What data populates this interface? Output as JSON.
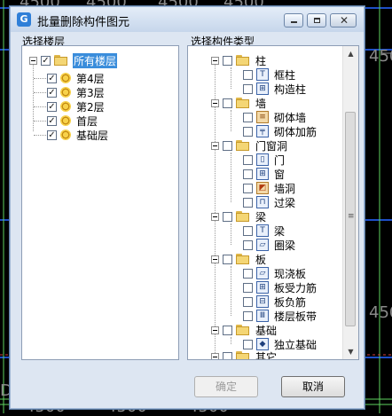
{
  "background": {
    "labels": [
      "4500",
      "4500",
      "4500",
      "4500",
      "450",
      "450",
      "4500",
      "4500",
      "4500",
      "D"
    ]
  },
  "dialog": {
    "title": "批量删除构件图元",
    "left_label": "选择楼层",
    "right_label": "选择构件类型",
    "ok_label": "确定",
    "cancel_label": "取消"
  },
  "floors": {
    "root": "所有楼层",
    "items": [
      "第4层",
      "第3层",
      "第2层",
      "首层",
      "基础层"
    ]
  },
  "types": {
    "groups": [
      {
        "label": "柱",
        "items": [
          "框柱",
          "构造柱"
        ]
      },
      {
        "label": "墙",
        "items": [
          "砌体墙",
          "砌体加筋"
        ]
      },
      {
        "label": "门窗洞",
        "items": [
          "门",
          "窗",
          "墙洞",
          "过梁"
        ]
      },
      {
        "label": "梁",
        "items": [
          "梁",
          "圈梁"
        ]
      },
      {
        "label": "板",
        "items": [
          "现浇板",
          "板受力筋",
          "板负筋",
          "楼层板带"
        ]
      },
      {
        "label": "基础",
        "items": [
          "独立基础"
        ]
      },
      {
        "label": "其它",
        "items": []
      }
    ]
  },
  "colors": {
    "selection": "#3a8ddb",
    "cad_grid": "#1e4fc7",
    "cad_lines": "#5fd35f"
  }
}
